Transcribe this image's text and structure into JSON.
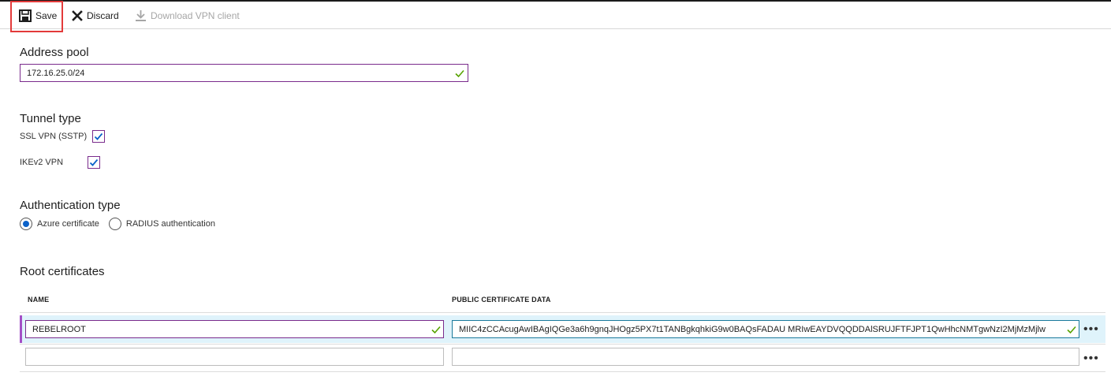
{
  "toolbar": {
    "save_label": "Save",
    "discard_label": "Discard",
    "download_label": "Download VPN client"
  },
  "address_pool": {
    "label": "Address pool",
    "value": "172.16.25.0/24"
  },
  "tunnel_type": {
    "label": "Tunnel type",
    "options": [
      {
        "label": "SSL VPN (SSTP)",
        "checked": true
      },
      {
        "label": "IKEv2 VPN",
        "checked": true
      }
    ]
  },
  "authentication_type": {
    "label": "Authentication type",
    "options": [
      {
        "label": "Azure certificate",
        "selected": true
      },
      {
        "label": "RADIUS authentication",
        "selected": false
      }
    ]
  },
  "root_certificates": {
    "label": "Root certificates",
    "columns": [
      "NAME",
      "PUBLIC CERTIFICATE DATA"
    ],
    "rows": [
      {
        "name": "REBELROOT",
        "data": "MIIC4zCCAcugAwIBAgIQGe3a6h9gnqJHOgz5PX7t1TANBgkqhkiG9w0BAQsFADAU MRIwEAYDVQQDDAlSRUJFTFJPT1QwHhcNMTgwNzI2MjMzMjlw"
      },
      {
        "name": "",
        "data": ""
      }
    ]
  },
  "colors": {
    "accent_purple": "#7a2b8c",
    "check_green": "#57a300",
    "radio_blue": "#0b62c9",
    "highlight_red": "#e33a3a",
    "selected_row": "#dff3fb"
  }
}
